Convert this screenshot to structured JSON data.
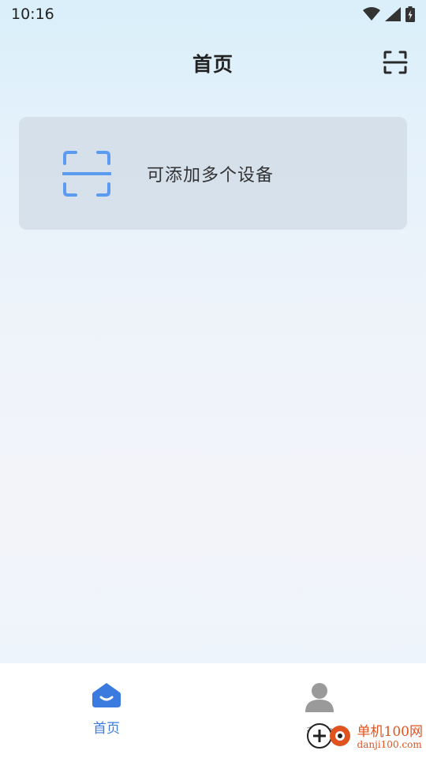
{
  "status_bar": {
    "time": "10:16"
  },
  "header": {
    "title": "首页"
  },
  "add_card": {
    "label": "可添加多个设备"
  },
  "tabs": [
    {
      "label": "首页",
      "active": true
    },
    {
      "label": "我的",
      "active": false
    }
  ],
  "watermark": {
    "name": "单机100网",
    "url": "danji100.com"
  },
  "colors": {
    "accent": "#3b7be0",
    "scan_icon": "#5b9bf0",
    "inactive": "#9a9a9a"
  }
}
